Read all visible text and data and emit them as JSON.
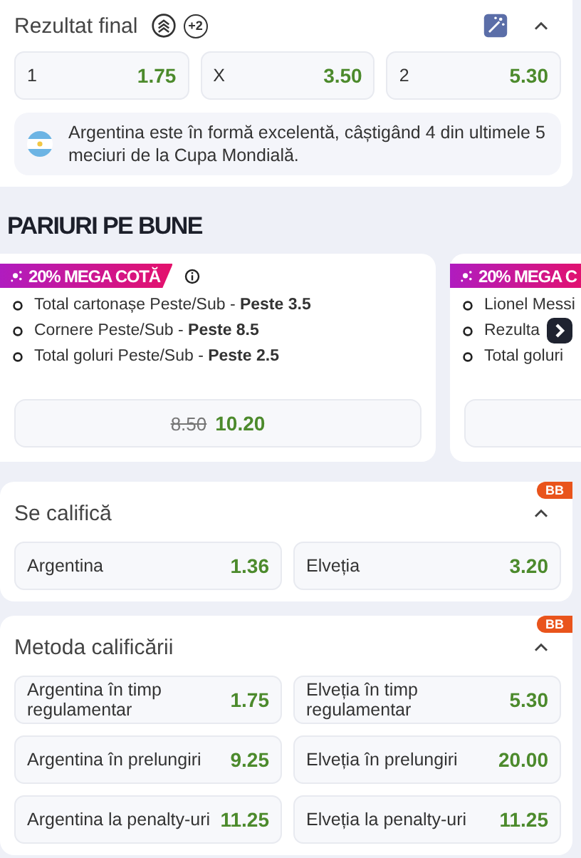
{
  "final_result": {
    "title": "Rezultat final",
    "badge": "+2",
    "expanded": true,
    "outcomes": [
      {
        "label": "1",
        "odds": "1.75"
      },
      {
        "label": "X",
        "odds": "3.50"
      },
      {
        "label": "2",
        "odds": "5.30"
      }
    ],
    "insight": "Argentina este în formă excelentă, câștigând 4 din ultimele 5 meciuri de la Cupa Mondială."
  },
  "combos": {
    "title": "PARIURI PE BUNE",
    "cards": [
      {
        "promo": "20% MEGA COTĂ",
        "info": true,
        "legs": [
          "Total cartonașe Peste/Sub - **Peste 3.5**",
          "Cornere Peste/Sub - **Peste 8.5**",
          "Total goluri Peste/Sub - **Peste 2.5**"
        ],
        "old_odds": "8.50",
        "odds": "10.20"
      },
      {
        "promo": "20% MEGA C",
        "info": false,
        "legs": [
          "Lionel Messi",
          "Rezulta",
          "Total goluri"
        ]
      }
    ]
  },
  "markets": [
    {
      "title": "Se califică",
      "tag": "BB",
      "expanded": true,
      "options": [
        {
          "label": "Argentina",
          "odds": "1.36"
        },
        {
          "label": "Elveția",
          "odds": "3.20"
        }
      ]
    },
    {
      "title": "Metoda calificării",
      "tag": "BB",
      "expanded": true,
      "options": [
        {
          "label": "Argentina în timp regulamentar",
          "odds": "1.75"
        },
        {
          "label": "Elveția în timp regulamentar",
          "odds": "5.30"
        },
        {
          "label": "Argentina în prelungiri",
          "odds": "9.25"
        },
        {
          "label": "Elveția în prelungiri",
          "odds": "20.00"
        },
        {
          "label": "Argentina la penalty-uri",
          "odds": "11.25"
        },
        {
          "label": "Elveția la penalty-uri",
          "odds": "11.25"
        }
      ]
    }
  ]
}
